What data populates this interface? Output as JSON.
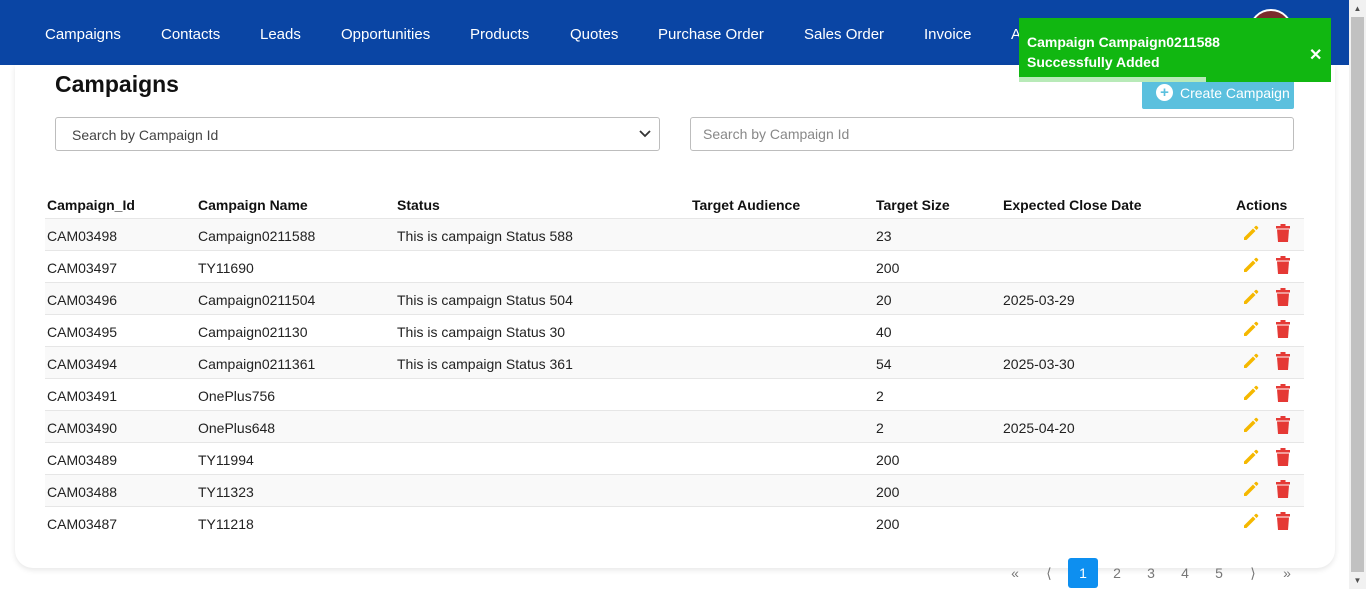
{
  "nav": {
    "items": [
      "Campaigns",
      "Contacts",
      "Leads",
      "Opportunities",
      "Products",
      "Quotes",
      "Purchase Order",
      "Sales Order",
      "Invoice",
      "A"
    ]
  },
  "page": {
    "title": "Campaigns",
    "create_button": "Create Campaign",
    "filter_select": "Search by Campaign Id",
    "search_placeholder": "Search by Campaign Id"
  },
  "table": {
    "columns": [
      "Campaign_Id",
      "Campaign Name",
      "Status",
      "Target Audience",
      "Target Size",
      "Expected Close Date",
      "Actions"
    ],
    "rows": [
      {
        "id": "CAM03498",
        "name": "Campaign0211588",
        "status": "This is campaign Status 588",
        "audience": "",
        "size": "23",
        "close": ""
      },
      {
        "id": "CAM03497",
        "name": "TY11690",
        "status": "",
        "audience": "",
        "size": "200",
        "close": ""
      },
      {
        "id": "CAM03496",
        "name": "Campaign0211504",
        "status": "This is campaign Status 504",
        "audience": "",
        "size": "20",
        "close": "2025-03-29"
      },
      {
        "id": "CAM03495",
        "name": "Campaign021130",
        "status": "This is campaign Status 30",
        "audience": "",
        "size": "40",
        "close": ""
      },
      {
        "id": "CAM03494",
        "name": "Campaign0211361",
        "status": "This is campaign Status 361",
        "audience": "",
        "size": "54",
        "close": "2025-03-30"
      },
      {
        "id": "CAM03491",
        "name": "OnePlus756",
        "status": "",
        "audience": "",
        "size": "2",
        "close": ""
      },
      {
        "id": "CAM03490",
        "name": "OnePlus648",
        "status": "",
        "audience": "",
        "size": "2",
        "close": "2025-04-20"
      },
      {
        "id": "CAM03489",
        "name": "TY11994",
        "status": "",
        "audience": "",
        "size": "200",
        "close": ""
      },
      {
        "id": "CAM03488",
        "name": "TY11323",
        "status": "",
        "audience": "",
        "size": "200",
        "close": ""
      },
      {
        "id": "CAM03487",
        "name": "TY11218",
        "status": "",
        "audience": "",
        "size": "200",
        "close": ""
      }
    ]
  },
  "pagination": {
    "first": "«",
    "prev": "⟨",
    "pages": [
      "1",
      "2",
      "3",
      "4",
      "5"
    ],
    "current": "1",
    "next": "⟩",
    "last": "»"
  },
  "toast": {
    "message": "Campaign Campaign0211588 Successfully Added",
    "close": "✕",
    "progress": 0.6
  },
  "colors": {
    "navbar": "#0a45a4",
    "create_button": "#5bc0de",
    "toast": "#11b711",
    "edit_icon": "#f5b800",
    "delete_icon": "#e53935",
    "active_page": "#0d8ff0"
  },
  "icons": {
    "edit": "pencil-icon",
    "delete": "trash-icon",
    "create": "plus-circle-icon"
  }
}
